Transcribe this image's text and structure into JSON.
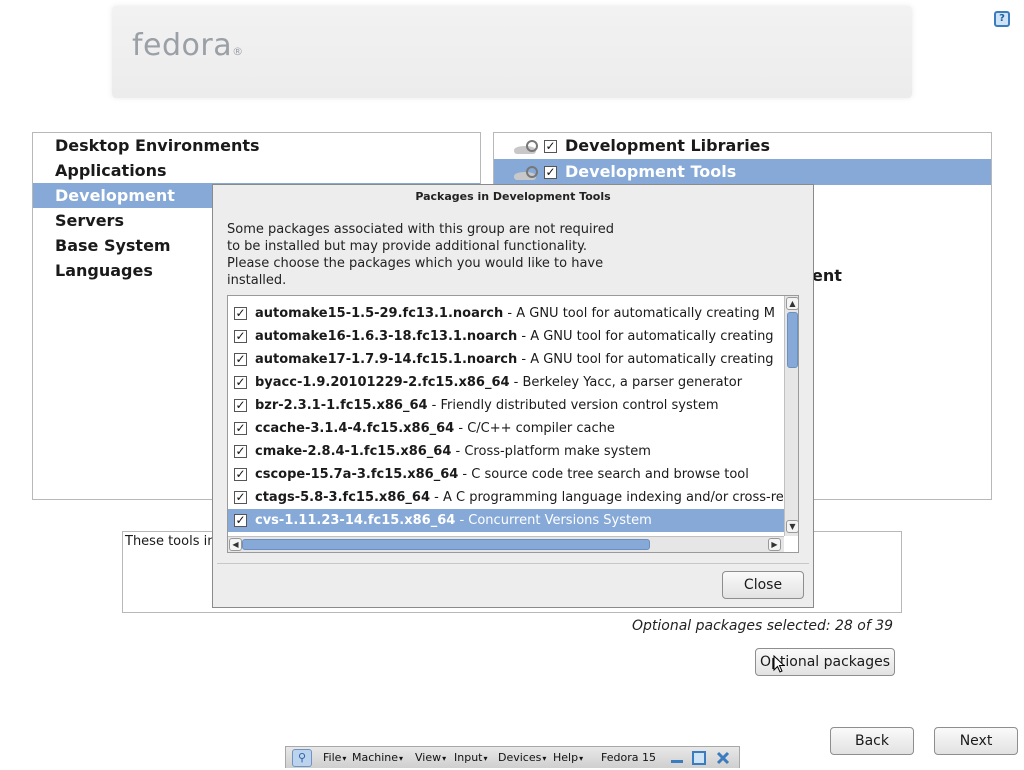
{
  "banner": {
    "logo_text": "fedora",
    "logo_mark": "®"
  },
  "help_icon": "help-icon",
  "categories": [
    {
      "label": "Desktop Environments",
      "selected": false
    },
    {
      "label": "Applications",
      "selected": false
    },
    {
      "label": "Development",
      "selected": true
    },
    {
      "label": "Servers",
      "selected": false
    },
    {
      "label": "Base System",
      "selected": false
    },
    {
      "label": "Languages",
      "selected": false
    }
  ],
  "groups": [
    {
      "label": "Development Libraries",
      "checked": true,
      "selected": false
    },
    {
      "label": "Development Tools",
      "checked": true,
      "selected": true
    }
  ],
  "partially_hidden_group_suffix": "ent",
  "description_text": "These tools in",
  "dialog": {
    "title": "Packages in Development Tools",
    "message": "Some packages associated with this group are not required to be installed but may provide additional functionality. Please choose the packages which you would like to have installed.",
    "packages": [
      {
        "name": "automake15-1.5-29.fc13.1.noarch",
        "desc": "A GNU tool for automatically creating M",
        "checked": true,
        "selected": false
      },
      {
        "name": "automake16-1.6.3-18.fc13.1.noarch",
        "desc": "A GNU tool for automatically creating",
        "checked": true,
        "selected": false
      },
      {
        "name": "automake17-1.7.9-14.fc15.1.noarch",
        "desc": "A GNU tool for automatically creating",
        "checked": true,
        "selected": false
      },
      {
        "name": "byacc-1.9.20101229-2.fc15.x86_64",
        "desc": "Berkeley Yacc, a parser generator",
        "checked": true,
        "selected": false
      },
      {
        "name": "bzr-2.3.1-1.fc15.x86_64",
        "desc": "Friendly distributed version control system",
        "checked": true,
        "selected": false
      },
      {
        "name": "ccache-3.1.4-4.fc15.x86_64",
        "desc": "C/C++ compiler cache",
        "checked": true,
        "selected": false
      },
      {
        "name": "cmake-2.8.4-1.fc15.x86_64",
        "desc": "Cross-platform make system",
        "checked": true,
        "selected": false
      },
      {
        "name": "cscope-15.7a-3.fc15.x86_64",
        "desc": "C source code tree search and browse tool",
        "checked": true,
        "selected": false
      },
      {
        "name": "ctags-5.8-3.fc15.x86_64",
        "desc": "A C programming language indexing and/or cross-re",
        "checked": true,
        "selected": false
      },
      {
        "name": "cvs-1.11.23-14.fc15.x86_64",
        "desc": "Concurrent Versions System",
        "checked": true,
        "selected": true
      }
    ],
    "close_label": "Close"
  },
  "optional_count_text": "Optional packages selected: 28 of 39",
  "optional_button_label": "Optional packages",
  "back_label": "Back",
  "next_label": "Next",
  "vm_bar": {
    "menus": [
      "File",
      "Machine",
      "View",
      "Input",
      "Devices",
      "Help"
    ],
    "title": "Fedora 15"
  },
  "colors": {
    "selection": "#86a9d8",
    "accent": "#3b7bbf"
  }
}
